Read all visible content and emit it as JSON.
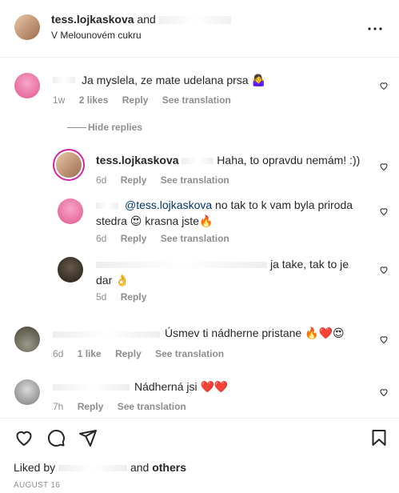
{
  "header": {
    "username": "tess.lojkaskova",
    "and_label": "and",
    "location": "V Melounovém cukru"
  },
  "comments": [
    {
      "text": "Ja myslela, ze mate udelana prsa 🤷‍♀️",
      "time": "1w",
      "likes": "2 likes",
      "reply": "Reply",
      "see_translation": "See translation"
    }
  ],
  "hide_replies": "Hide replies",
  "replies": [
    {
      "username": "tess.lojkaskova",
      "text": "Haha, to opravdu nemám! :))",
      "time": "6d",
      "reply": "Reply",
      "see_translation": "See translation"
    },
    {
      "mention": "@tess.lojkaskova",
      "text_line1": "no tak to k vam byla priroda",
      "text_line2": "stedra 😍 krasna jste🔥",
      "time": "6d",
      "reply": "Reply",
      "see_translation": "See translation"
    },
    {
      "text_line1": "ja take, tak to je",
      "text_line2": "dar 👌",
      "time": "5d",
      "reply": "Reply"
    }
  ],
  "comments2": [
    {
      "text": "Úsmev ti nádherne pristane 🔥❤️😍",
      "time": "6d",
      "likes": "1 like",
      "reply": "Reply",
      "see_translation": "See translation"
    },
    {
      "text": "Nádherná jsi ❤️❤️",
      "time": "7h",
      "reply": "Reply",
      "see_translation": "See translation"
    }
  ],
  "footer": {
    "liked_by": "Liked by",
    "and_others_and": "and",
    "and_others": "others",
    "date": "AUGUST 16"
  },
  "icons": {
    "more": "more-options-icon",
    "heart": "heart-icon",
    "comment": "comment-icon",
    "share": "share-icon",
    "save": "bookmark-icon"
  }
}
